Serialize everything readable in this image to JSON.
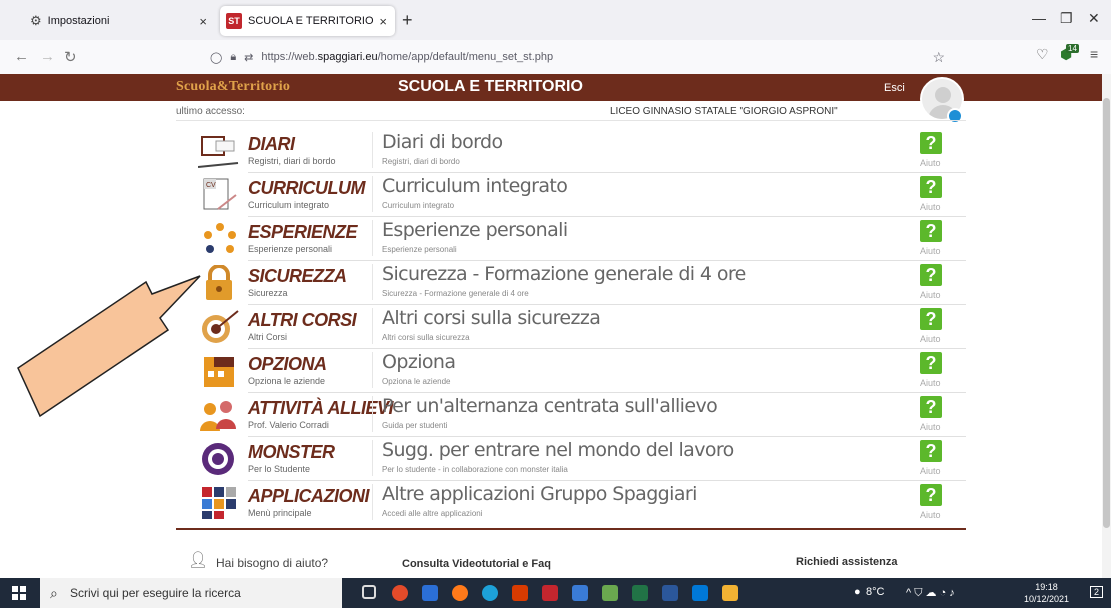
{
  "browser": {
    "tabs": [
      {
        "label": "Impostazioni",
        "icon": "gear-icon"
      },
      {
        "label": "SCUOLA E TERRITORIO",
        "icon": "spaggiari-favicon"
      }
    ],
    "favicon_text": "ST",
    "url_prefix": "https://web.",
    "url_domain": "spaggiari.eu",
    "url_path": "/home/app/default/menu_set_st.php",
    "extension_badge": "14"
  },
  "header": {
    "brand": "Scuola&Territorio",
    "title": "SCUOLA E TERRITORIO",
    "logout": "Esci",
    "colors": {
      "bar": "#6d2c1c",
      "brand": "#e0a24a"
    }
  },
  "subheader": {
    "last_access": "ultimo accesso:",
    "school": "LICEO GINNASIO STATALE \"GIORGIO ASPRONI\""
  },
  "menu": [
    {
      "title": "DIARI",
      "subtitle": "Registri, diari di bordo",
      "desc": "Diari di bordo",
      "desc_sub": "Registri, diari di bordo",
      "icon": "diary-icon"
    },
    {
      "title": "CURRICULUM",
      "subtitle": "Curriculum integrato",
      "desc": "Curriculum integrato",
      "desc_sub": "Curriculum integrato",
      "icon": "cv-icon"
    },
    {
      "title": "ESPERIENZE",
      "subtitle": "Esperienze personali",
      "desc": "Esperienze personali",
      "desc_sub": "Esperienze personali",
      "icon": "experience-icon"
    },
    {
      "title": "SICUREZZA",
      "subtitle": "Sicurezza",
      "desc": "Sicurezza - Formazione generale di 4 ore",
      "desc_sub": "Sicurezza - Formazione generale di 4 ore",
      "icon": "padlock-icon"
    },
    {
      "title": "ALTRI CORSI",
      "subtitle": "Altri Corsi",
      "desc": "Altri corsi sulla sicurezza",
      "desc_sub": "Altri corsi sulla sicurezza",
      "icon": "target-icon"
    },
    {
      "title": "OPZIONA",
      "subtitle": "Opziona le aziende",
      "desc": "Opziona",
      "desc_sub": "Opziona le aziende",
      "icon": "building-icon"
    },
    {
      "title": "ATTIVITÀ ALLIEVI",
      "subtitle": "Prof. Valerio Corradi",
      "desc": "Per un'alternanza centrata sull'allievo",
      "desc_sub": "Guida per studenti",
      "icon": "students-icon"
    },
    {
      "title": "MONSTER",
      "subtitle": "Per lo Studente",
      "desc": "Sugg. per entrare nel mondo del lavoro",
      "desc_sub": "Per lo studente - in collaborazione con monster italia",
      "icon": "monster-icon"
    },
    {
      "title": "APPLICAZIONI",
      "subtitle": "Menù principale",
      "desc": "Altre applicazioni Gruppo Spaggiari",
      "desc_sub": "Accedi alle altre applicazioni",
      "icon": "apps-grid-icon"
    }
  ],
  "help": {
    "symbol": "?",
    "label": "Aiuto"
  },
  "footer": {
    "help_question": "Hai bisogno di aiuto?",
    "tutorial": "Consulta Videotutorial e Faq",
    "assistance": "Richiedi assistenza"
  },
  "taskbar": {
    "search_placeholder": "Scrivi qui per eseguire la ricerca",
    "temperature": "8°C",
    "time": "19:18",
    "date": "10/12/2021",
    "notifications": "2"
  }
}
